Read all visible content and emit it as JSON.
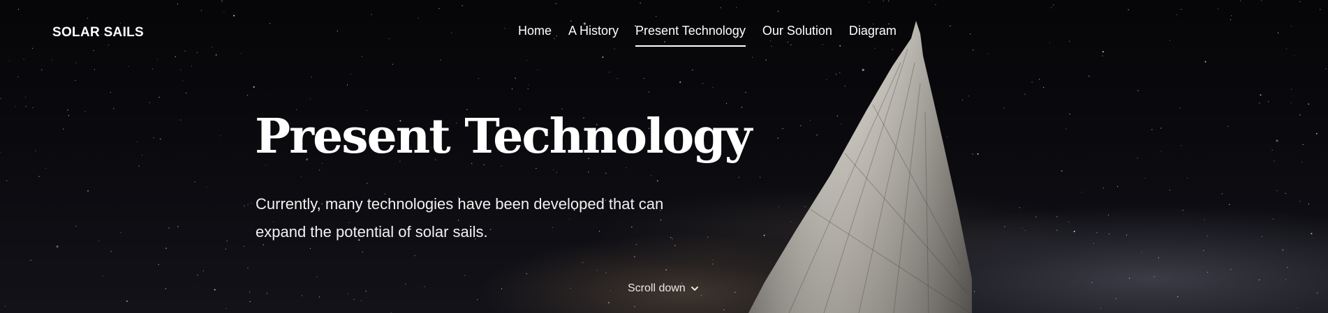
{
  "header": {
    "brand": "SOLAR SAILS",
    "nav": [
      {
        "label": "Home",
        "active": false
      },
      {
        "label": "A History",
        "active": false
      },
      {
        "label": "Present Technology",
        "active": true
      },
      {
        "label": "Our Solution",
        "active": false
      },
      {
        "label": "Diagram",
        "active": false
      }
    ]
  },
  "hero": {
    "title": "Present Technology",
    "lead": "Currently, many technologies have been developed that can expand the potential of solar sails.",
    "scroll_label": "Scroll down",
    "scroll_icon": "chevron-down-icon",
    "background_image": "starry-sky-with-solar-sail"
  }
}
